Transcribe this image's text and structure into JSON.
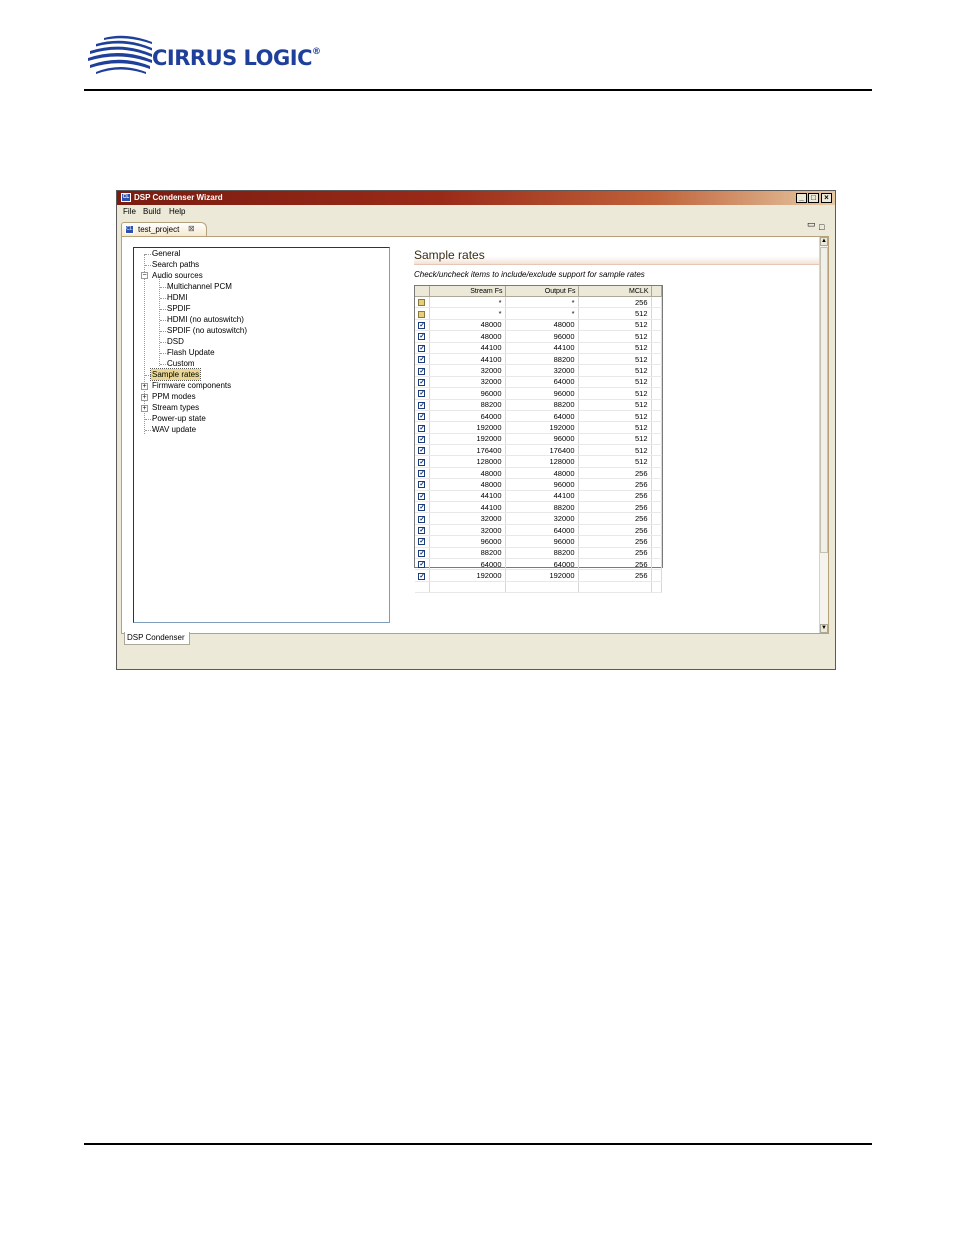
{
  "brand": {
    "name": "CIRRUS LOGIC",
    "registered_mark": "®",
    "color": "#1e3f9a"
  },
  "window": {
    "title": "DSP Condenser Wizard",
    "title_icon": "app-icon",
    "controls": [
      "minimize-icon",
      "maximize-icon",
      "close-icon"
    ]
  },
  "menu": {
    "items": [
      "File",
      "Build",
      "Help"
    ]
  },
  "editor_tab": {
    "label": "test_project",
    "icon": "project-icon"
  },
  "tree": {
    "items": [
      {
        "label": "General",
        "level": 0,
        "expander": ""
      },
      {
        "label": "Search paths",
        "level": 0,
        "expander": ""
      },
      {
        "label": "Audio sources",
        "level": 0,
        "expander": "−"
      },
      {
        "label": "Multichannel PCM",
        "level": 1,
        "expander": ""
      },
      {
        "label": "HDMI",
        "level": 1,
        "expander": ""
      },
      {
        "label": "SPDIF",
        "level": 1,
        "expander": ""
      },
      {
        "label": "HDMI (no autoswitch)",
        "level": 1,
        "expander": ""
      },
      {
        "label": "SPDIF (no autoswitch)",
        "level": 1,
        "expander": ""
      },
      {
        "label": "DSD",
        "level": 1,
        "expander": ""
      },
      {
        "label": "Flash Update",
        "level": 1,
        "expander": ""
      },
      {
        "label": "Custom",
        "level": 1,
        "expander": ""
      },
      {
        "label": "Sample rates",
        "level": 0,
        "expander": "",
        "selected": true
      },
      {
        "label": "Firmware components",
        "level": 0,
        "expander": "+"
      },
      {
        "label": "PPM modes",
        "level": 0,
        "expander": "+"
      },
      {
        "label": "Stream types",
        "level": 0,
        "expander": "+"
      },
      {
        "label": "Power-up state",
        "level": 0,
        "expander": ""
      },
      {
        "label": "WAV update",
        "level": 0,
        "expander": ""
      }
    ]
  },
  "panel": {
    "title": "Sample rates",
    "description": "Check/uncheck items to include/exclude support for sample rates"
  },
  "grid": {
    "headers": [
      "",
      "Stream Fs",
      "Output Fs",
      "MCLK"
    ],
    "rows": [
      {
        "checked": false,
        "stream": "*",
        "output": "*",
        "mclk": "256"
      },
      {
        "checked": false,
        "stream": "*",
        "output": "*",
        "mclk": "512"
      },
      {
        "checked": true,
        "stream": "48000",
        "output": "48000",
        "mclk": "512"
      },
      {
        "checked": true,
        "stream": "48000",
        "output": "96000",
        "mclk": "512"
      },
      {
        "checked": true,
        "stream": "44100",
        "output": "44100",
        "mclk": "512"
      },
      {
        "checked": true,
        "stream": "44100",
        "output": "88200",
        "mclk": "512"
      },
      {
        "checked": true,
        "stream": "32000",
        "output": "32000",
        "mclk": "512"
      },
      {
        "checked": true,
        "stream": "32000",
        "output": "64000",
        "mclk": "512"
      },
      {
        "checked": true,
        "stream": "96000",
        "output": "96000",
        "mclk": "512"
      },
      {
        "checked": true,
        "stream": "88200",
        "output": "88200",
        "mclk": "512"
      },
      {
        "checked": true,
        "stream": "64000",
        "output": "64000",
        "mclk": "512"
      },
      {
        "checked": true,
        "stream": "192000",
        "output": "192000",
        "mclk": "512"
      },
      {
        "checked": true,
        "stream": "192000",
        "output": "96000",
        "mclk": "512"
      },
      {
        "checked": true,
        "stream": "176400",
        "output": "176400",
        "mclk": "512"
      },
      {
        "checked": true,
        "stream": "128000",
        "output": "128000",
        "mclk": "512"
      },
      {
        "checked": true,
        "stream": "48000",
        "output": "48000",
        "mclk": "256"
      },
      {
        "checked": true,
        "stream": "48000",
        "output": "96000",
        "mclk": "256"
      },
      {
        "checked": true,
        "stream": "44100",
        "output": "44100",
        "mclk": "256"
      },
      {
        "checked": true,
        "stream": "44100",
        "output": "88200",
        "mclk": "256"
      },
      {
        "checked": true,
        "stream": "32000",
        "output": "32000",
        "mclk": "256"
      },
      {
        "checked": true,
        "stream": "32000",
        "output": "64000",
        "mclk": "256"
      },
      {
        "checked": true,
        "stream": "96000",
        "output": "96000",
        "mclk": "256"
      },
      {
        "checked": true,
        "stream": "88200",
        "output": "88200",
        "mclk": "256"
      },
      {
        "checked": true,
        "stream": "64000",
        "output": "64000",
        "mclk": "256"
      },
      {
        "checked": true,
        "stream": "192000",
        "output": "192000",
        "mclk": "256"
      },
      {
        "checked": null,
        "stream": "",
        "output": "",
        "mclk": ""
      }
    ]
  },
  "bottom_tab": {
    "label": "DSP Condenser"
  }
}
